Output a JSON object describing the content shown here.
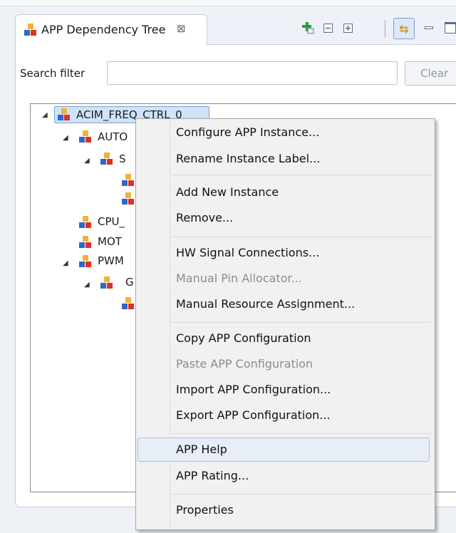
{
  "view": {
    "tab_title": "APP Dependency Tree",
    "tab_close_glyph": "⊠",
    "toolbar": {
      "icons": [
        "add-app-icon",
        "collapse-all-icon",
        "expand-all-icon",
        "link-with-editor-icon",
        "minimize-icon",
        "maximize-icon"
      ]
    }
  },
  "search": {
    "label": "Search filter",
    "value": "",
    "placeholder": "",
    "clear_label": "Clear"
  },
  "tree": {
    "nodes": [
      {
        "label": "ACIM_FREQ_CTRL_0",
        "level": 0,
        "expanded": true,
        "selected": true
      },
      {
        "label": "AUTO",
        "level": 1,
        "expanded": true
      },
      {
        "label": "S",
        "level": 2,
        "expanded": true
      },
      {
        "label": "",
        "level": 3
      },
      {
        "label": "",
        "level": 3
      },
      {
        "label": "CPU_",
        "level": 1
      },
      {
        "label": "MOT",
        "level": 1
      },
      {
        "label": "PWM",
        "level": 1,
        "expanded": true
      },
      {
        "label": "G",
        "level": 2,
        "expanded": true
      },
      {
        "label": "",
        "level": 3
      }
    ]
  },
  "context_menu": {
    "items": [
      {
        "label": "Configure APP Instance...",
        "enabled": true
      },
      {
        "label": "Rename Instance Label...",
        "enabled": true
      },
      {
        "label": "Add New Instance",
        "enabled": true
      },
      {
        "label": "Remove...",
        "enabled": true
      },
      {
        "label": "HW Signal Connections...",
        "enabled": true
      },
      {
        "label": "Manual Pin Allocator...",
        "enabled": false
      },
      {
        "label": "Manual Resource Assignment...",
        "enabled": true
      },
      {
        "label": "Copy APP Configuration",
        "enabled": true
      },
      {
        "label": "Paste APP Configuration",
        "enabled": false
      },
      {
        "label": "Import APP Configuration...",
        "enabled": true
      },
      {
        "label": "Export APP Configuration...",
        "enabled": true
      },
      {
        "label": "APP Help",
        "enabled": true,
        "highlighted": true
      },
      {
        "label": "APP Rating...",
        "enabled": true
      },
      {
        "label": "Properties",
        "enabled": true
      }
    ]
  },
  "colors": {
    "selection": "#cfe3f9",
    "menu_highlight": "#e7eef8",
    "disabled_text": "#8c8c8c"
  }
}
